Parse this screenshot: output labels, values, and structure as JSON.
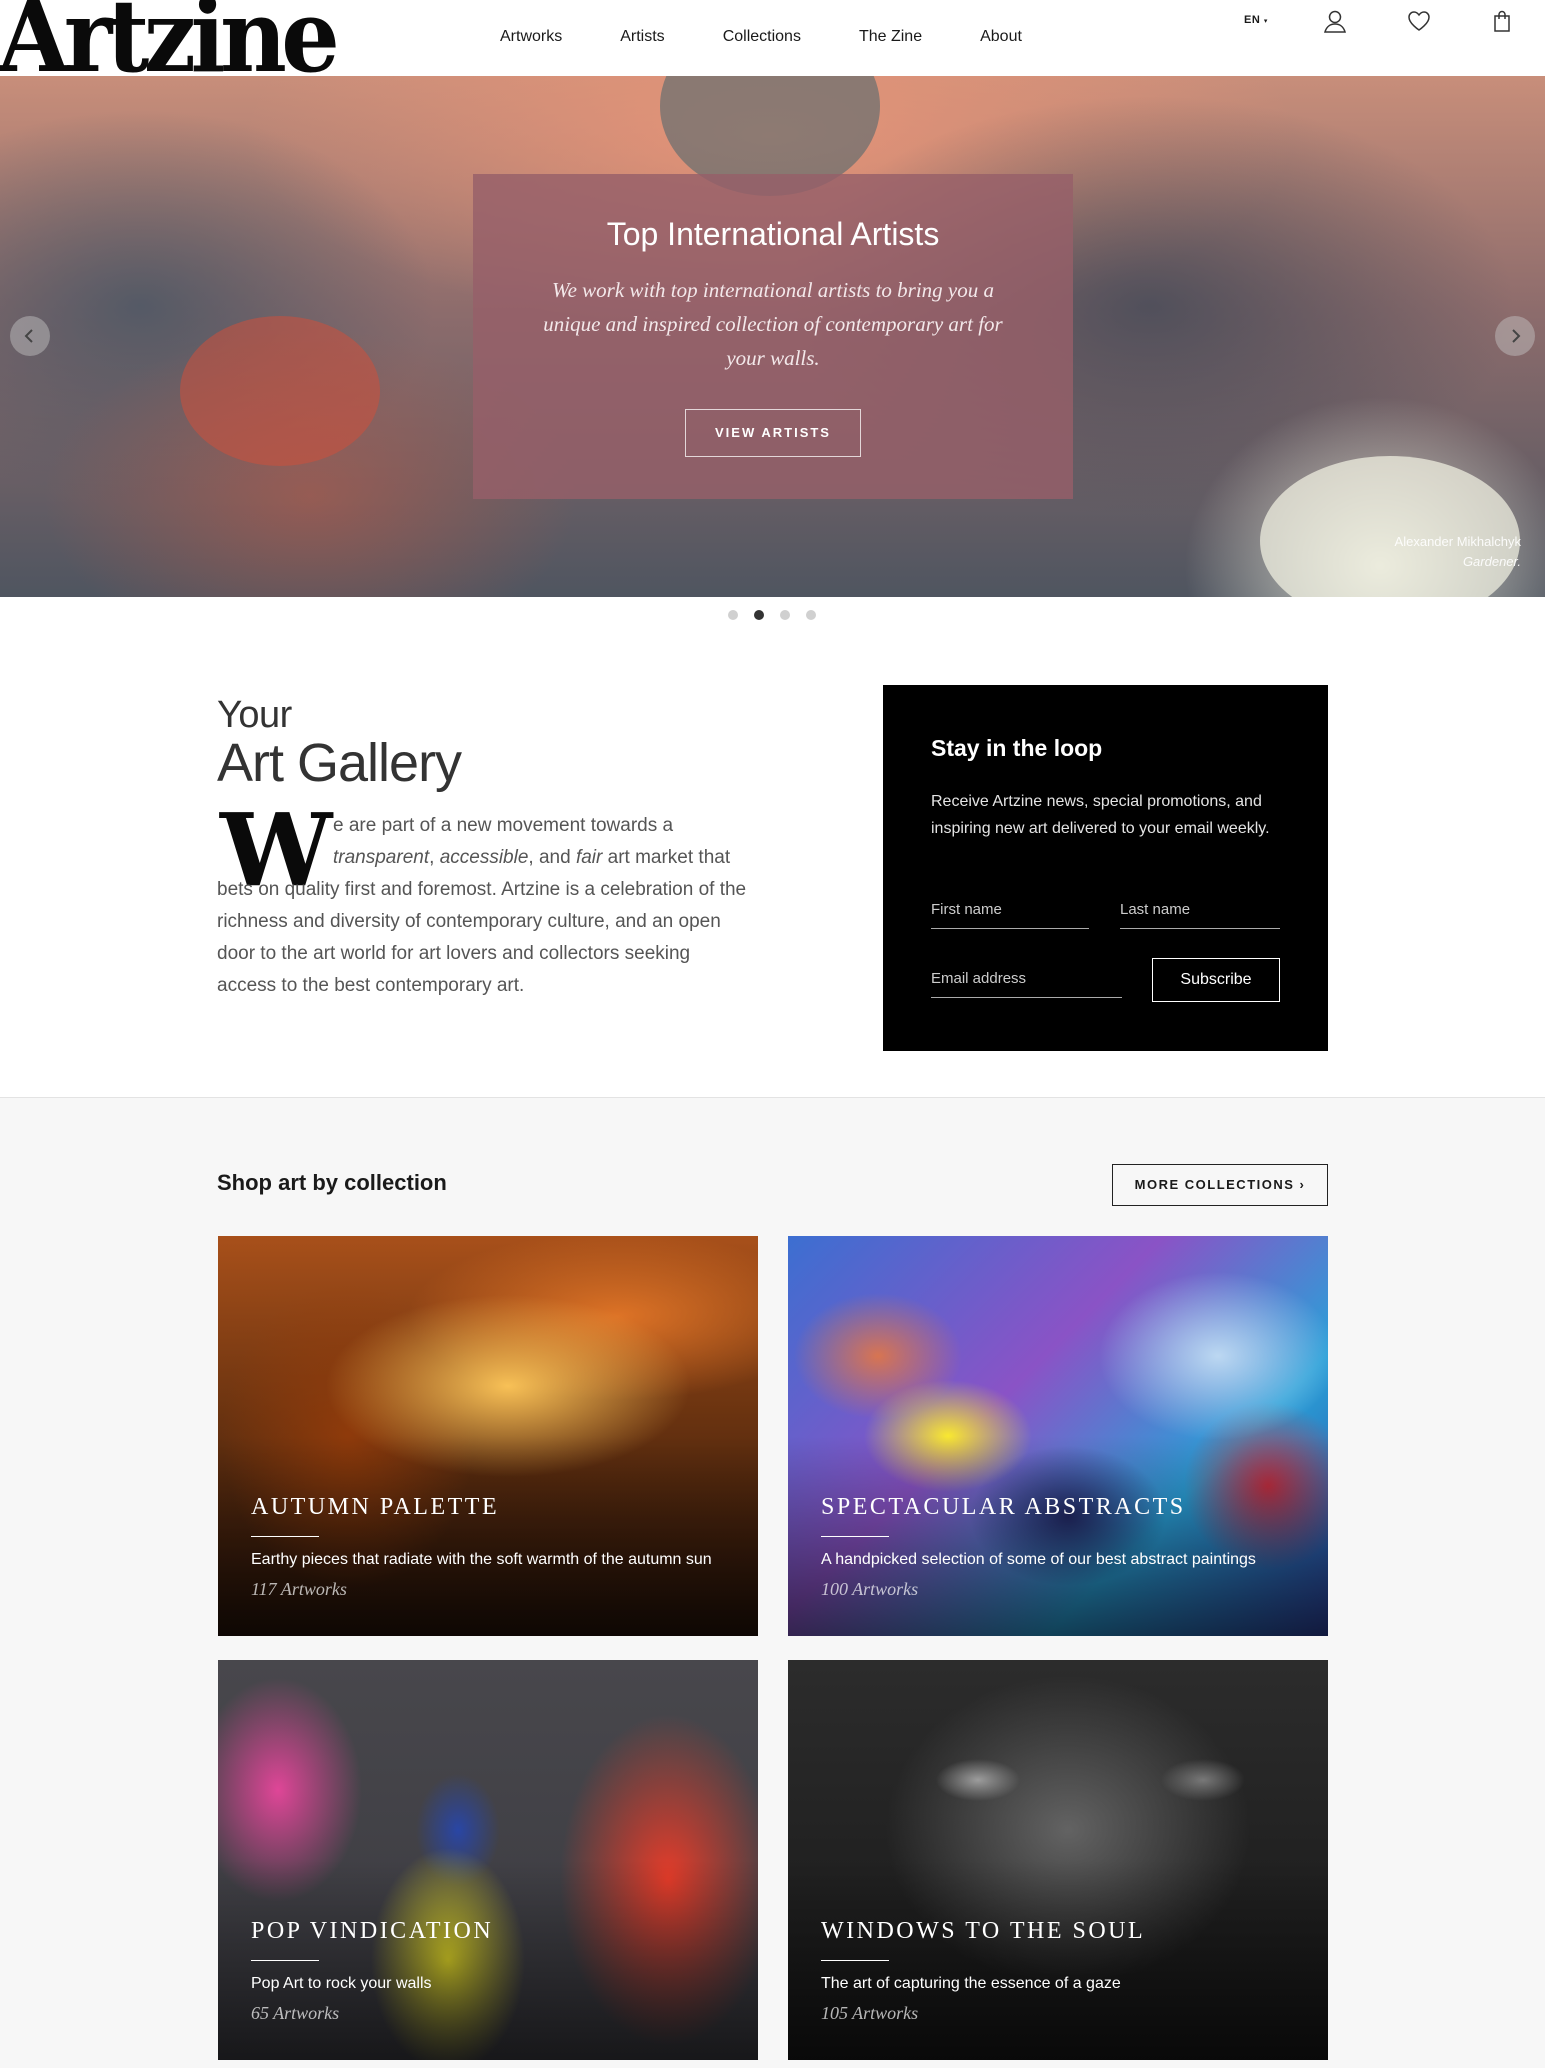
{
  "header": {
    "logo": "Artzine",
    "nav": [
      "Artworks",
      "Artists",
      "Collections",
      "The Zine",
      "About"
    ],
    "language": "EN",
    "icons": [
      "user-icon",
      "heart-icon",
      "shopping-bag-icon"
    ]
  },
  "hero": {
    "title": "Top International Artists",
    "text": "We work with top international artists to bring you a unique and inspired collection of contemporary art for your walls.",
    "button": "VIEW ARTISTS",
    "caption_artist": "Alexander Mikhalchyk",
    "caption_title": "Gardener.",
    "slides_total": 4,
    "active_slide": 2
  },
  "intro": {
    "subtitle": "Your",
    "title": "Art Gallery",
    "dropcap": "W",
    "para_first": "e are part of a new movement towards a",
    "para_em1": "transparent",
    "para_sep1": ", ",
    "para_em2": "accessible",
    "para_sep2": ", and ",
    "para_em3": "fair",
    "para_rest": " art market that bets on quality first and foremost. Artzine is a celebration of the richness and diversity of contemporary culture, and an open door to the art world for art lovers and collectors seeking access to the best contemporary art."
  },
  "newsletter": {
    "title": "Stay in the loop",
    "text": "Receive Artzine news, special promotions, and inspiring new art delivered to your email weekly.",
    "first_name_placeholder": "First name",
    "last_name_placeholder": "Last name",
    "email_placeholder": "Email address",
    "button": "Subscribe"
  },
  "collections": {
    "heading": "Shop art by collection",
    "more_button": "MORE COLLECTIONS ›",
    "items": [
      {
        "title": "AUTUMN PALETTE",
        "description": "Earthy pieces that radiate with the soft warmth of the autumn sun",
        "count": "117 Artworks"
      },
      {
        "title": "SPECTACULAR ABSTRACTS",
        "description": "A handpicked selection of some of our best abstract paintings",
        "count": "100 Artworks"
      },
      {
        "title": "POP VINDICATION",
        "description": "Pop Art to rock your walls",
        "count": "65 Artworks"
      },
      {
        "title": "WINDOWS TO THE SOUL",
        "description": "The art of capturing the essence of a gaze",
        "count": "105 Artworks"
      }
    ]
  },
  "colors": {
    "hero_panel": "#965f69",
    "newsletter_bg": "#000000",
    "collections_bg": "#f7f7f7",
    "text": "#1a1a1a"
  }
}
